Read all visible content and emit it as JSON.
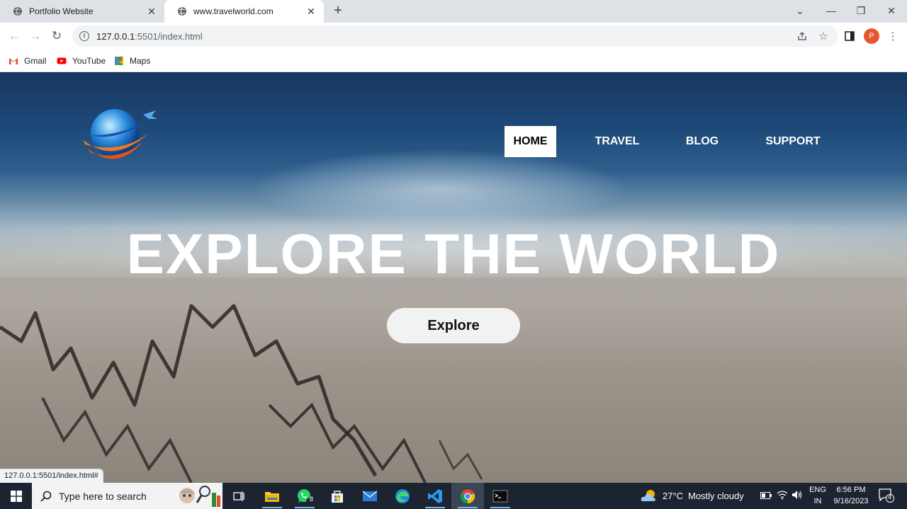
{
  "browser": {
    "tabs": [
      {
        "title": "Portfolio Website",
        "active": false
      },
      {
        "title": "www.travelworld.com",
        "active": true
      }
    ],
    "address": {
      "host": "127.0.0.1",
      "path": ":5501/index.html"
    },
    "bookmarks": [
      {
        "label": "Gmail",
        "icon": "gmail-icon"
      },
      {
        "label": "YouTube",
        "icon": "youtube-icon"
      },
      {
        "label": "Maps",
        "icon": "maps-icon"
      }
    ],
    "profile_initial": "P",
    "status_url": "127.0.0.1:5501/index.html#"
  },
  "page": {
    "nav": [
      {
        "label": "HOME",
        "active": true
      },
      {
        "label": "TRAVEL",
        "active": false
      },
      {
        "label": "BLOG",
        "active": false
      },
      {
        "label": "SUPPORT",
        "active": false
      }
    ],
    "hero_title": "EXPLORE THE WORLD",
    "cta_label": "Explore"
  },
  "taskbar": {
    "search_placeholder": "Type here to search",
    "whatsapp_badge": "8",
    "weather": {
      "temp": "27°C",
      "condition": "Mostly cloudy"
    },
    "language": {
      "line1": "ENG",
      "line2": "IN"
    },
    "clock": {
      "time": "6:56 PM",
      "date": "9/16/2023"
    },
    "notifications_count": "4"
  },
  "colors": {
    "profile": "#e8542e",
    "taskbar": "#1c2431",
    "cta_bg": "#f2f2f2"
  }
}
